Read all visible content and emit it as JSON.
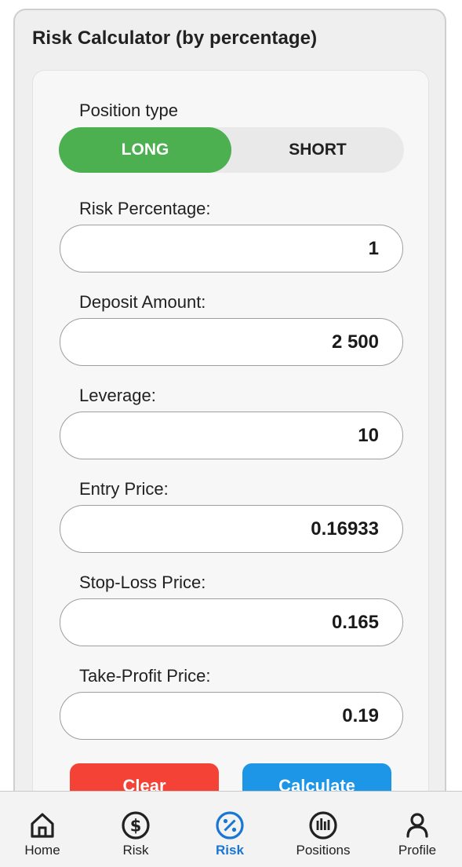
{
  "card": {
    "title": "Risk Calculator (by percentage)"
  },
  "position_type": {
    "label": "Position type",
    "options": [
      "LONG",
      "SHORT"
    ],
    "selected": "LONG"
  },
  "fields": {
    "risk_percentage": {
      "label": "Risk Percentage:",
      "value": "1"
    },
    "deposit_amount": {
      "label": "Deposit Amount:",
      "value": "2 500"
    },
    "leverage": {
      "label": "Leverage:",
      "value": "10"
    },
    "entry_price": {
      "label": "Entry Price:",
      "value": "0.16933"
    },
    "stop_loss_price": {
      "label": "Stop-Loss Price:",
      "value": "0.165"
    },
    "take_profit_price": {
      "label": "Take-Profit Price:",
      "value": "0.19"
    }
  },
  "actions": {
    "clear": "Clear",
    "calculate": "Calculate"
  },
  "nav": {
    "items": [
      {
        "label": "Home",
        "icon": "home-icon"
      },
      {
        "label": "Risk",
        "icon": "dollar-circle-icon"
      },
      {
        "label": "Risk",
        "icon": "percent-circle-icon",
        "active": true
      },
      {
        "label": "Positions",
        "icon": "positions-chart-icon"
      },
      {
        "label": "Profile",
        "icon": "person-icon"
      }
    ]
  },
  "colors": {
    "long_active": "#4caf50",
    "clear": "#f44336",
    "calculate": "#1e96e8",
    "nav_active": "#1976d2"
  }
}
